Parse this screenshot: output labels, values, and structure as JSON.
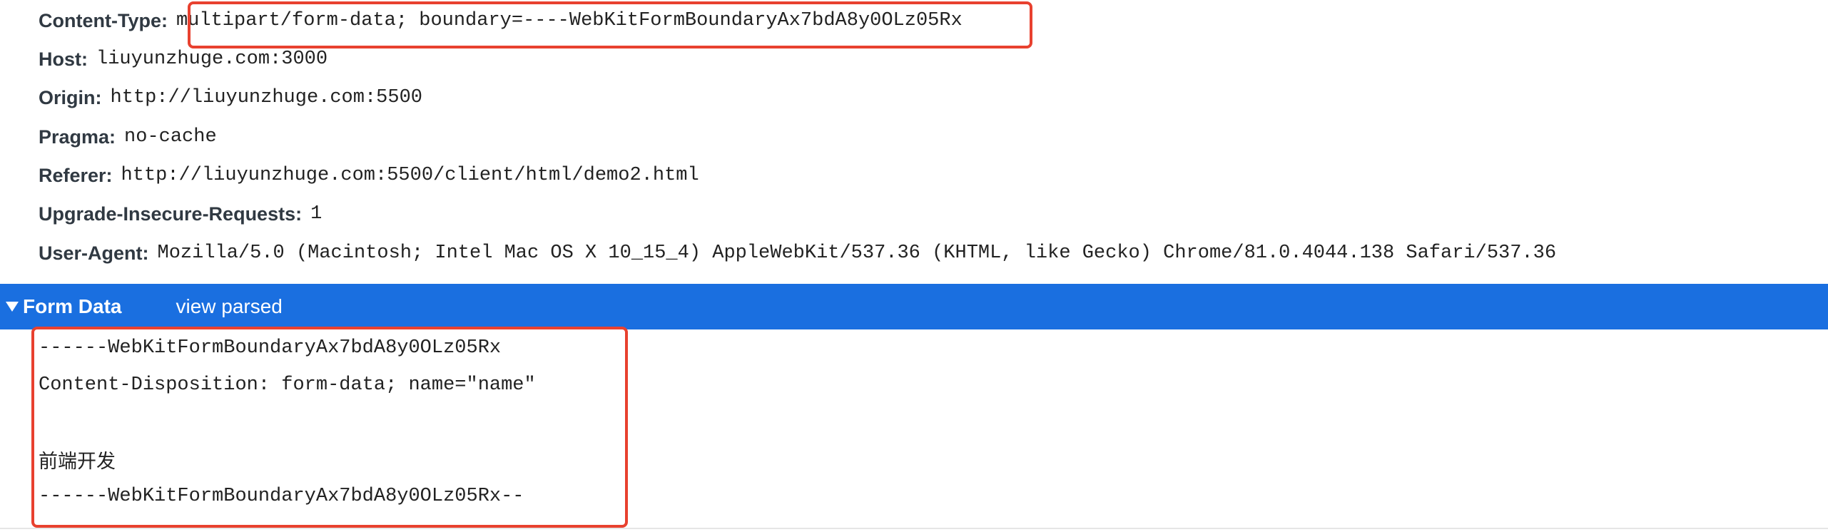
{
  "request_headers": [
    {
      "name": "Content-Type:",
      "value": "multipart/form-data; boundary=----WebKitFormBoundaryAx7bdA8y0OLz05Rx"
    },
    {
      "name": "Host:",
      "value": "liuyunzhuge.com:3000"
    },
    {
      "name": "Origin:",
      "value": "http://liuyunzhuge.com:5500"
    },
    {
      "name": "Pragma:",
      "value": "no-cache"
    },
    {
      "name": "Referer:",
      "value": "http://liuyunzhuge.com:5500/client/html/demo2.html"
    },
    {
      "name": "Upgrade-Insecure-Requests:",
      "value": "1"
    },
    {
      "name": "User-Agent:",
      "value": "Mozilla/5.0 (Macintosh; Intel Mac OS X 10_15_4) AppleWebKit/537.36 (KHTML, like Gecko) Chrome/81.0.4044.138 Safari/537.36"
    }
  ],
  "form_data_section": {
    "title": "Form Data",
    "toggle_link": "view parsed",
    "expanded": true,
    "lines": [
      "------WebKitFormBoundaryAx7bdA8y0OLz05Rx",
      "Content-Disposition: form-data; name=\"name\"",
      "",
      "前端开发",
      "------WebKitFormBoundaryAx7bdA8y0OLz05Rx--"
    ]
  },
  "colors": {
    "section_bar": "#1a6fe0",
    "highlight_border": "#e8412f",
    "header_name": "#303942",
    "text": "#222222"
  }
}
